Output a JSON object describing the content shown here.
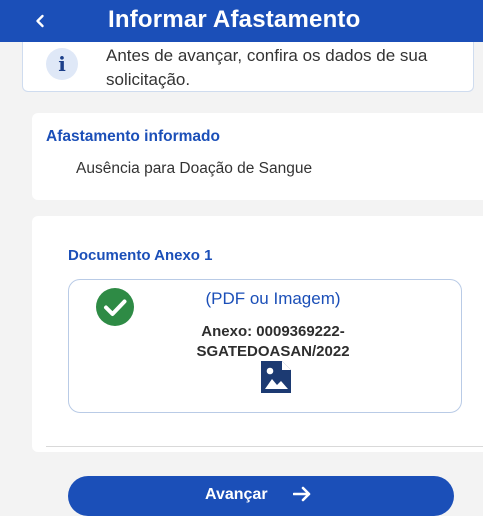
{
  "header": {
    "title": "Informar Afastamento",
    "back_icon": "chevron-left-icon"
  },
  "info": {
    "icon": "info-icon",
    "text": "Antes de avançar, confira os dados de sua solicitação."
  },
  "leave": {
    "heading": "Afastamento informado",
    "value": "Ausência para Doação de Sangue"
  },
  "document": {
    "heading": "Documento Anexo 1",
    "type_label": "(PDF ou Imagem)",
    "file_line1": "Anexo: 0009369222-",
    "file_line2": "SGATEDOASAN/2022",
    "status_icon": "check-circle-icon",
    "file_icon": "image-file-icon"
  },
  "actions": {
    "advance_label": "Avançar",
    "advance_icon": "arrow-right-icon"
  },
  "colors": {
    "primary": "#1b4fb8",
    "success": "#2e8b45",
    "background": "#f3f3f3"
  }
}
